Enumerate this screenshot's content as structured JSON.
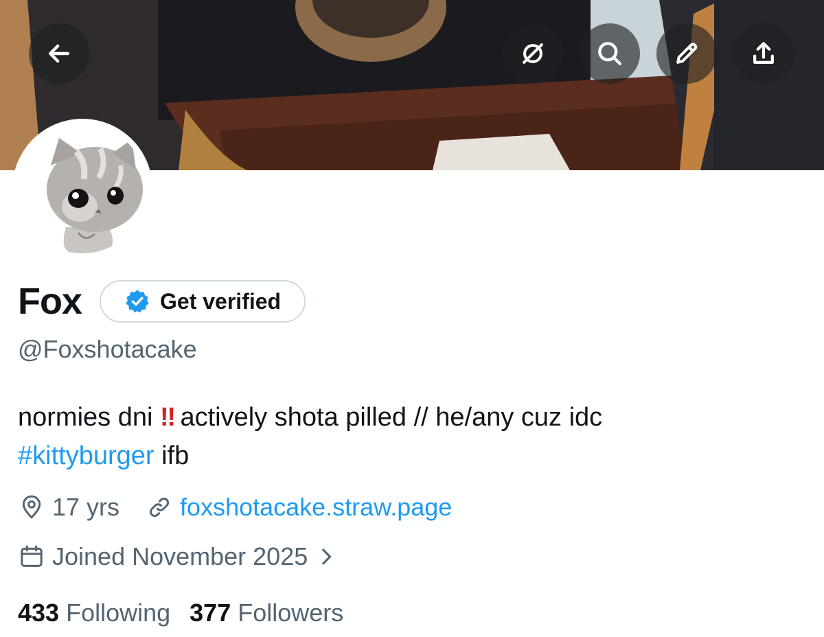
{
  "header": {
    "back": "back-arrow-icon",
    "actions": [
      "grok-icon",
      "search-icon",
      "edit-pencil-icon",
      "share-icon"
    ],
    "button_bg": "#1e2024"
  },
  "profile": {
    "display_name": "Fox",
    "verify_label": "Get verified",
    "handle": "@Foxshotacake",
    "bio_text_1": "normies dni ",
    "bio_emoji": "‼",
    "bio_text_2": " actively shota pilled // he/any cuz idc",
    "bio_hashtag": "#kittyburger",
    "bio_text_3": " ifb",
    "location": "17 yrs",
    "website": "foxshotacake.straw.page",
    "joined": "Joined November 2025",
    "following_count": "433",
    "following_label": "Following",
    "followers_count": "377",
    "followers_label": "Followers"
  },
  "colors": {
    "link": "#1d9bf0",
    "secondary_text": "#536471",
    "primary_text": "#0f1419",
    "verified_badge": "#1d9bf0",
    "emoji_red": "#d91f26"
  }
}
